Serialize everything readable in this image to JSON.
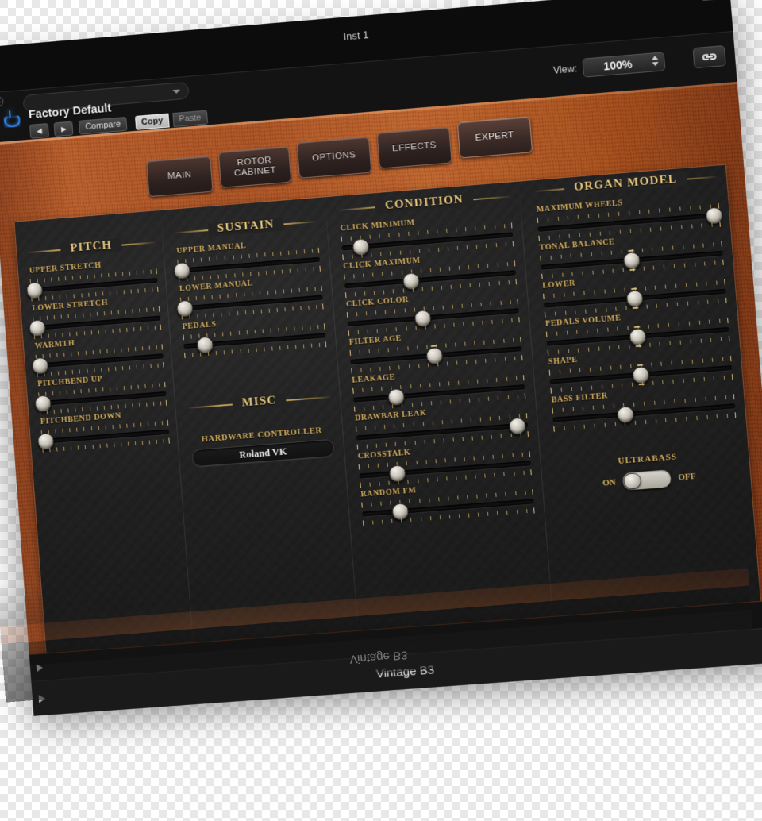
{
  "window": {
    "title": "Inst 1",
    "close_icon": "close-icon",
    "power_icon": "power-icon"
  },
  "header": {
    "preset_name": "Factory Default",
    "preset_dropdown_icon": "chevron-down-icon",
    "prev_label": "◀",
    "next_label": "▶",
    "compare_label": "Compare",
    "copy_label": "Copy",
    "paste_label": "Paste",
    "view_label": "View:",
    "view_value": "100%",
    "link_icon": "link-icon"
  },
  "tabs": [
    {
      "label": "MAIN",
      "active": false
    },
    {
      "label": "ROTOR\nCABINET",
      "line1": "ROTOR",
      "line2": "CABINET",
      "active": false
    },
    {
      "label": "OPTIONS",
      "active": false
    },
    {
      "label": "EFFECTS",
      "active": false
    },
    {
      "label": "EXPERT",
      "active": true
    }
  ],
  "sections": {
    "pitch": {
      "title": "PITCH",
      "controls": [
        {
          "label": "UPPER STRETCH",
          "value": 0
        },
        {
          "label": "LOWER STRETCH",
          "value": 0
        },
        {
          "label": "WARMTH",
          "value": 0
        },
        {
          "label": "PITCHBEND UP",
          "value": 0
        },
        {
          "label": "PITCHBEND DOWN",
          "value": 0
        }
      ]
    },
    "sustain": {
      "title": "SUSTAIN",
      "controls": [
        {
          "label": "UPPER MANUAL",
          "value": 0
        },
        {
          "label": "LOWER MANUAL",
          "value": 0
        },
        {
          "label": "PEDALS",
          "value": 12
        }
      ]
    },
    "misc": {
      "title": "MISC",
      "hardware_controller_label": "HARDWARE CONTROLLER",
      "hardware_controller_value": "Roland VK"
    },
    "condition": {
      "title": "CONDITION",
      "controls": [
        {
          "label": "CLICK MINIMUM",
          "value": 11
        },
        {
          "label": "CLICK MAXIMUM",
          "value": 39
        },
        {
          "label": "CLICK COLOR",
          "value": 44
        },
        {
          "label": "FILTER AGE",
          "value": 49
        },
        {
          "label": "LEAKAGE",
          "value": 25
        },
        {
          "label": "DRAWBAR LEAK",
          "value": 94
        },
        {
          "label": "CROSSTALK",
          "value": 22
        },
        {
          "label": "RANDOM FM",
          "value": 22
        }
      ]
    },
    "organ_model": {
      "title": "ORGAN MODEL",
      "controls": [
        {
          "label": "MAXIMUM WHEELS",
          "value": 100
        },
        {
          "label": "TONAL BALANCE",
          "value": 50,
          "center": true
        },
        {
          "label": "LOWER",
          "value": 50,
          "center": true
        },
        {
          "label": "PEDALS VOLUME",
          "value": 50,
          "center": true
        },
        {
          "label": "SHAPE",
          "value": 50,
          "center": true
        },
        {
          "label": "BASS FILTER",
          "value": 40
        }
      ],
      "ultrabass": {
        "title": "ULTRABASS",
        "on_label": "ON",
        "off_label": "OFF",
        "state": "ON"
      }
    }
  },
  "footer": {
    "plugin_name": "Vintage B3",
    "disclosure_icon": "disclosure-triangle-icon"
  },
  "colors": {
    "wood": "#a8562a",
    "gold": "#d6b060",
    "gold_bright": "#e7c77e",
    "panel": "#232323",
    "chrome": "#0d0d0d",
    "power_blue": "#2f8fff"
  }
}
